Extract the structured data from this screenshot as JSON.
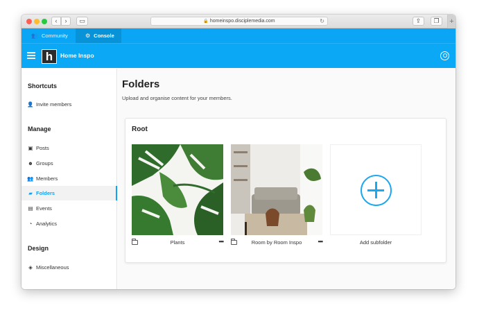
{
  "browser": {
    "url": "homeinspo.disciplemedia.com"
  },
  "topbar": {
    "tabs": [
      {
        "label": "Community"
      },
      {
        "label": "Console"
      }
    ]
  },
  "header": {
    "logo_letter": "h",
    "brand": "Home Inspo"
  },
  "sidebar": {
    "sections": [
      {
        "title": "Shortcuts",
        "items": [
          {
            "label": "Invite members",
            "icon": "user-plus-icon"
          }
        ]
      },
      {
        "title": "Manage",
        "items": [
          {
            "label": "Posts",
            "icon": "posts-icon"
          },
          {
            "label": "Groups",
            "icon": "groups-icon"
          },
          {
            "label": "Members",
            "icon": "members-icon"
          },
          {
            "label": "Folders",
            "icon": "folder-icon",
            "active": true
          },
          {
            "label": "Events",
            "icon": "calendar-icon"
          },
          {
            "label": "Analytics",
            "icon": "gauge-icon"
          }
        ]
      },
      {
        "title": "Design",
        "items": [
          {
            "label": "Miscellaneous",
            "icon": "layers-icon"
          }
        ]
      }
    ]
  },
  "main": {
    "title": "Folders",
    "subtitle": "Upload and organise content for your members.",
    "card_title": "Root",
    "folders": [
      {
        "name": "Plants",
        "more": "•••"
      },
      {
        "name": "Room by Room Inspo",
        "more": "•••"
      }
    ],
    "add_label": "Add subfolder"
  },
  "colors": {
    "accent": "#0aa5f5",
    "console_tab": "#0893d8"
  }
}
